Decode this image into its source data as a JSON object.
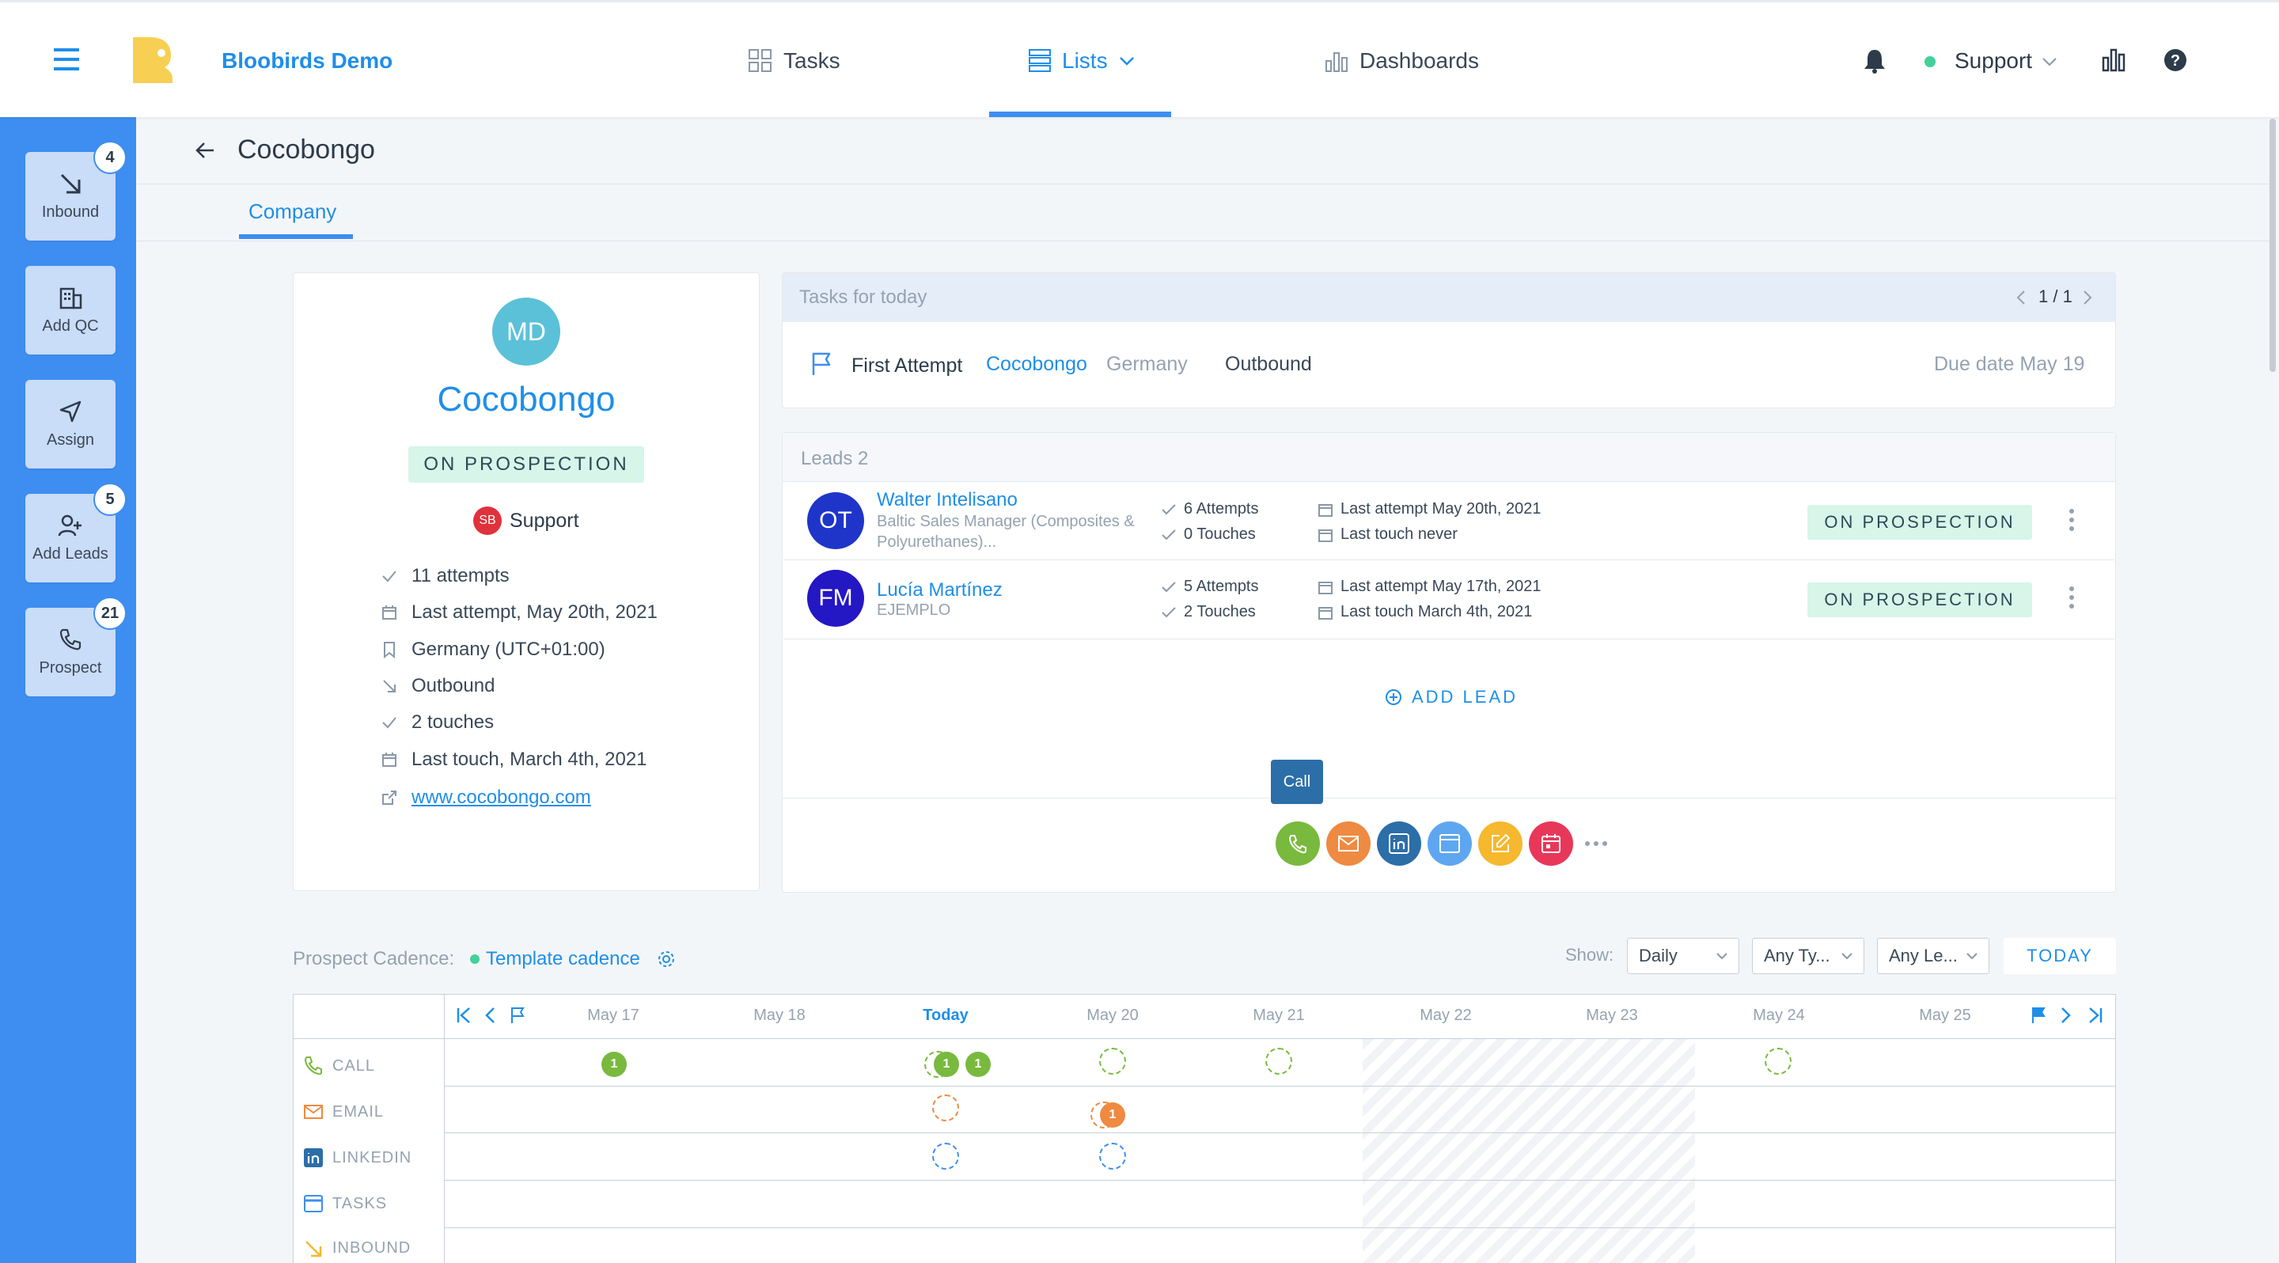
{
  "topbar": {
    "brand": "Bloobirds Demo",
    "nav": [
      {
        "label": "Tasks",
        "icon": "grid-icon"
      },
      {
        "label": "Lists",
        "icon": "list-icon",
        "active": true
      },
      {
        "label": "Dashboards",
        "icon": "bar-chart-icon"
      }
    ],
    "user": "Support"
  },
  "sidebar": {
    "items": [
      {
        "label": "Inbound",
        "badge": "4",
        "icon": "arrow-down-right-icon"
      },
      {
        "label": "Add QC",
        "badge": "",
        "icon": "building-icon"
      },
      {
        "label": "Assign",
        "badge": "",
        "icon": "send-icon"
      },
      {
        "label": "Add Leads",
        "badge": "5",
        "icon": "add-user-icon"
      },
      {
        "label": "Prospect",
        "badge": "21",
        "icon": "phone-icon"
      }
    ]
  },
  "page": {
    "title": "Cocobongo",
    "tab": "Company"
  },
  "company": {
    "initials": "MD",
    "name": "Cocobongo",
    "status": "ON PROSPECTION",
    "owner_initials": "SB",
    "owner": "Support",
    "stats": [
      {
        "icon": "check-icon",
        "text": "11 attempts"
      },
      {
        "icon": "calendar-icon",
        "text": "Last attempt, May 20th, 2021"
      },
      {
        "icon": "bookmark-icon",
        "text": "Germany (UTC+01:00)"
      },
      {
        "icon": "arrow-down-right-icon",
        "text": "Outbound"
      },
      {
        "icon": "check-icon",
        "text": "2 touches"
      },
      {
        "icon": "calendar-icon",
        "text": "Last touch, March 4th, 2021"
      },
      {
        "icon": "external-link-icon",
        "text": "www.cocobongo.com"
      }
    ]
  },
  "tasks": {
    "header": "Tasks for today",
    "pager": "1 / 1",
    "task": {
      "type": "First Attempt",
      "company": "Cocobongo",
      "country": "Germany",
      "source": "Outbound",
      "due": "Due date May 19"
    }
  },
  "leads": {
    "header": "Leads 2",
    "items": [
      {
        "initials": "OT",
        "name": "Walter Intelisano",
        "role1": "Baltic Sales Manager (Composites &",
        "role2": "Polyurethanes)...",
        "attempts": "6 Attempts",
        "touches": "0 Touches",
        "last_attempt": "Last attempt May 20th, 2021",
        "last_touch": "Last touch never",
        "status": "ON PROSPECTION",
        "avatar_color": "#1f35c9"
      },
      {
        "initials": "FM",
        "name": "Lucía Martínez",
        "role1": "EJEMPLO",
        "role2": "",
        "attempts": "5 Attempts",
        "touches": "2 Touches",
        "last_attempt": "Last attempt May 17th, 2021",
        "last_touch": "Last touch March 4th, 2021",
        "status": "ON PROSPECTION",
        "avatar_color": "#2417c4"
      }
    ],
    "add_lead": "ADD LEAD",
    "tooltip": "Call"
  },
  "actions": [
    {
      "icon": "phone-icon",
      "color": "#79b93e"
    },
    {
      "icon": "mail-icon",
      "color": "#ee8a42"
    },
    {
      "icon": "linkedin-icon",
      "color": "#2c6ea8"
    },
    {
      "icon": "task-icon",
      "color": "#5ea7f0"
    },
    {
      "icon": "note-icon",
      "color": "#f5b82e"
    },
    {
      "icon": "meeting-icon",
      "color": "#e8385a"
    }
  ],
  "cadence": {
    "label": "Prospect Cadence:",
    "template": "Template cadence",
    "show_label": "Show:",
    "filters": [
      "Daily",
      "Any Ty...",
      "Any Le..."
    ],
    "today_button": "TODAY",
    "dates": [
      "May 17",
      "May 18",
      "Today",
      "May 20",
      "May 21",
      "May 22",
      "May 23",
      "May 24",
      "May 25"
    ],
    "channels": [
      "CALL",
      "EMAIL",
      "LINKEDIN",
      "TASKS",
      "INBOUND"
    ],
    "call_count_a": "1",
    "call_count_b": "1",
    "call_count_c": "1",
    "email_count": "1"
  }
}
